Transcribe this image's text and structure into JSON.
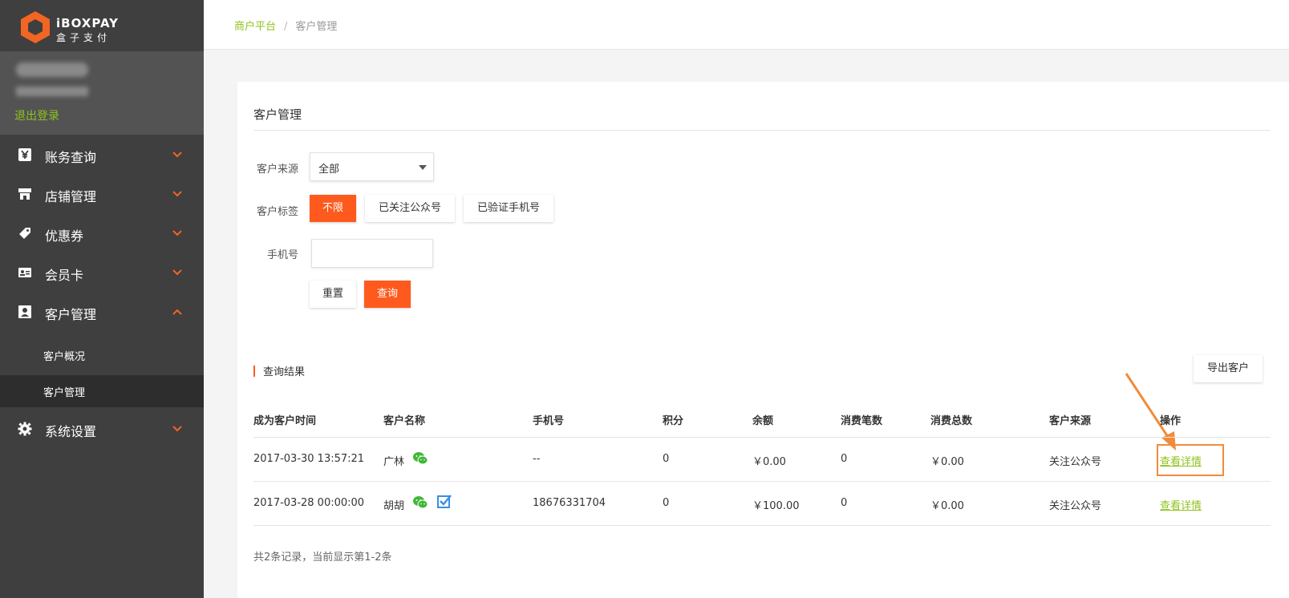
{
  "logo": {
    "brand": "iBOXPAY",
    "brand_cn": "盒子支付"
  },
  "user": {
    "logout_label": "退出登录"
  },
  "menu": [
    {
      "label": "账务查询",
      "icon": "yen-icon"
    },
    {
      "label": "店铺管理",
      "icon": "store-icon"
    },
    {
      "label": "优惠券",
      "icon": "coupon-icon"
    },
    {
      "label": "会员卡",
      "icon": "member-card-icon"
    },
    {
      "label": "客户管理",
      "icon": "customer-icon",
      "expanded": true
    },
    {
      "label": "系统设置",
      "icon": "gear-icon"
    }
  ],
  "submenu": [
    {
      "label": "客户概况"
    },
    {
      "label": "客户管理",
      "active": true
    }
  ],
  "breadcrumb": {
    "root": "商户平台",
    "separator": "/",
    "current": "客户管理"
  },
  "page": {
    "title": "客户管理"
  },
  "filters": {
    "source_label": "客户来源",
    "source_value": "全部",
    "tag_label": "客户标签",
    "tags": [
      "不限",
      "已关注公众号",
      "已验证手机号"
    ],
    "phone_label": "手机号",
    "phone_value": "",
    "reset_label": "重置",
    "query_label": "查询"
  },
  "results": {
    "title": "查询结果",
    "export_label": "导出客户",
    "columns": [
      "成为客户时间",
      "客户名称",
      "手机号",
      "积分",
      "余额",
      "消费笔数",
      "消费总数",
      "客户来源",
      "操作"
    ],
    "rows": [
      {
        "time": "2017-03-30 13:57:21",
        "name": "广林",
        "phone": "--",
        "points": "0",
        "balance": "￥0.00",
        "count": "0",
        "total": "￥0.00",
        "source": "关注公众号",
        "action": "查看详情"
      },
      {
        "time": "2017-03-28 00:00:00",
        "name": "胡胡",
        "phone": "18676331704",
        "points": "0",
        "balance": "￥100.00",
        "count": "0",
        "total": "￥0.00",
        "source": "关注公众号",
        "action": "查看详情"
      }
    ],
    "summary": "共2条记录，当前显示第1-2条"
  },
  "colors": {
    "accent": "#fe5a1e",
    "link": "#8fc31f",
    "sidebar": "#3f3f3f"
  }
}
